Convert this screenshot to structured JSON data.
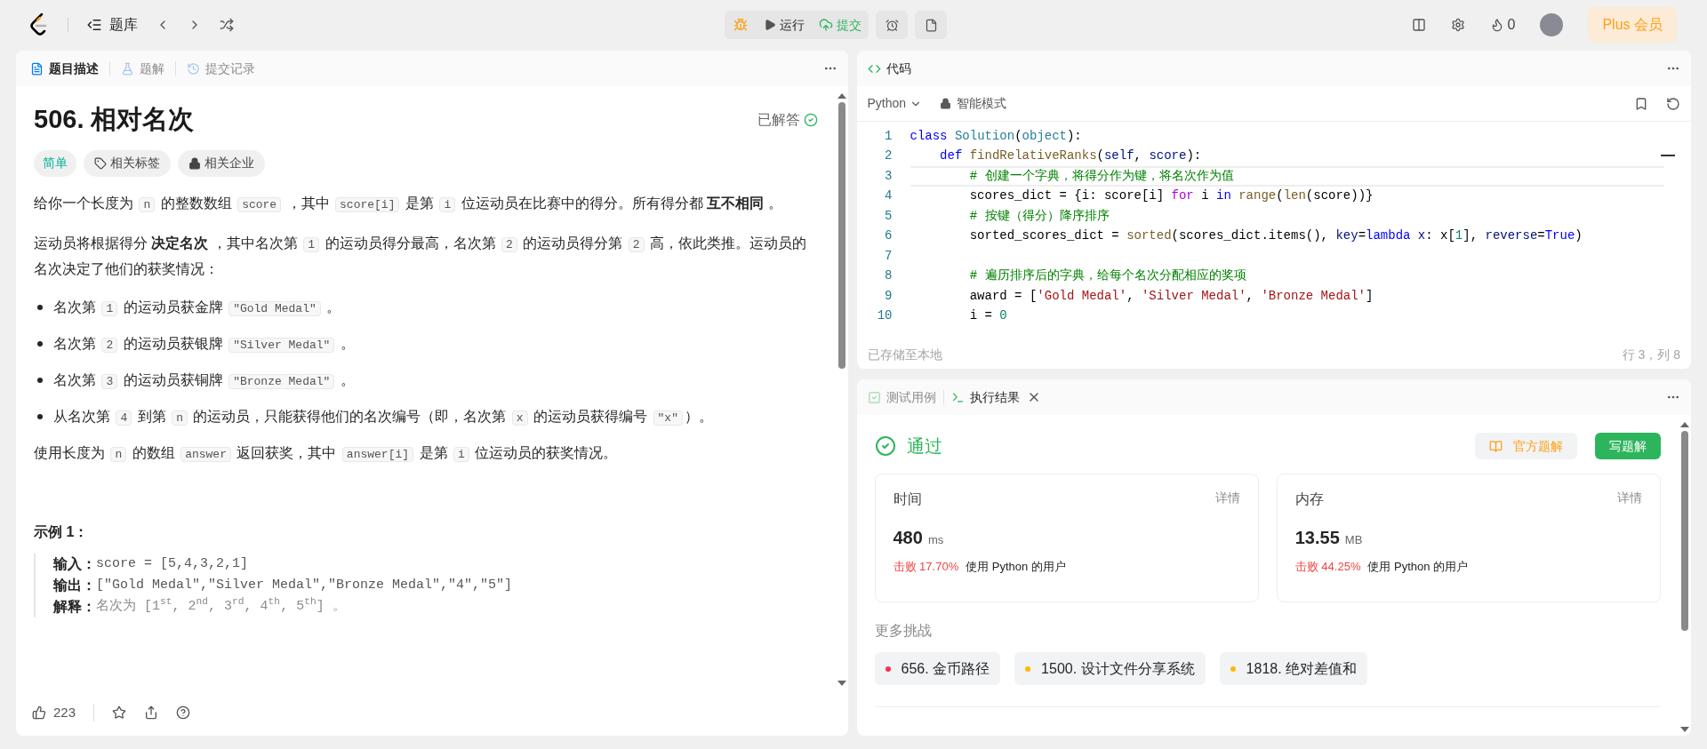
{
  "topbar": {
    "nav_title": "题库",
    "actions": [
      {
        "kind": "debug"
      },
      {
        "kind": "run",
        "label": "运行"
      },
      {
        "kind": "submit",
        "label": "提交"
      },
      {
        "kind": "timer"
      },
      {
        "kind": "note"
      }
    ],
    "fire_count": "0",
    "plus_label": "Plus 会员"
  },
  "problem": {
    "tabs": [
      {
        "label": "题目描述",
        "kind": "description",
        "selected": true
      },
      {
        "label": "题解",
        "kind": "solutions",
        "selected": false
      },
      {
        "label": "提交记录",
        "kind": "submissions",
        "selected": false
      }
    ],
    "title": "506. 相对名次",
    "status": "已解答",
    "tags": [
      {
        "label": "简单",
        "kind": "difficulty"
      },
      {
        "label": "相关标签",
        "kind": "topics"
      },
      {
        "label": "相关企业",
        "kind": "companies"
      }
    ],
    "blocks": [
      {
        "kind": "paragraph",
        "segments": [
          {
            "kind": "text",
            "text": "给你一个长度为 "
          },
          {
            "kind": "code",
            "text": "n"
          },
          {
            "kind": "text",
            "text": " 的整数数组 "
          },
          {
            "kind": "code",
            "text": "score"
          },
          {
            "kind": "text",
            "text": " ，其中 "
          },
          {
            "kind": "code",
            "text": "score[i]"
          },
          {
            "kind": "text",
            "text": " 是第 "
          },
          {
            "kind": "code",
            "text": "i"
          },
          {
            "kind": "text",
            "text": " 位运动员在比赛中的得分。所有得分都 "
          },
          {
            "kind": "bold",
            "text": "互不相同"
          },
          {
            "kind": "text",
            "text": " 。"
          }
        ]
      },
      {
        "kind": "paragraph",
        "segments": [
          {
            "kind": "text",
            "text": "运动员将根据得分 "
          },
          {
            "kind": "bold",
            "text": "决定名次"
          },
          {
            "kind": "text",
            "text": " ，其中名次第 "
          },
          {
            "kind": "code",
            "text": "1"
          },
          {
            "kind": "text",
            "text": " 的运动员得分最高，名次第 "
          },
          {
            "kind": "code",
            "text": "2"
          },
          {
            "kind": "text",
            "text": " 的运动员得分第 "
          },
          {
            "kind": "code",
            "text": "2"
          },
          {
            "kind": "text",
            "text": " 高，依此类推。运动员的名次决定了他们的获奖情况："
          }
        ]
      },
      {
        "kind": "bullet",
        "segments": [
          {
            "kind": "text",
            "text": "名次第 "
          },
          {
            "kind": "code",
            "text": "1"
          },
          {
            "kind": "text",
            "text": " 的运动员获金牌 "
          },
          {
            "kind": "code",
            "text": "\"Gold Medal\""
          },
          {
            "kind": "text",
            "text": " 。"
          }
        ]
      },
      {
        "kind": "bullet",
        "segments": [
          {
            "kind": "text",
            "text": "名次第 "
          },
          {
            "kind": "code",
            "text": "2"
          },
          {
            "kind": "text",
            "text": " 的运动员获银牌 "
          },
          {
            "kind": "code",
            "text": "\"Silver Medal\""
          },
          {
            "kind": "text",
            "text": " 。"
          }
        ]
      },
      {
        "kind": "bullet",
        "segments": [
          {
            "kind": "text",
            "text": "名次第 "
          },
          {
            "kind": "code",
            "text": "3"
          },
          {
            "kind": "text",
            "text": " 的运动员获铜牌 "
          },
          {
            "kind": "code",
            "text": "\"Bronze Medal\""
          },
          {
            "kind": "text",
            "text": " 。"
          }
        ]
      },
      {
        "kind": "bullet",
        "segments": [
          {
            "kind": "text",
            "text": "从名次第 "
          },
          {
            "kind": "code",
            "text": "4"
          },
          {
            "kind": "text",
            "text": " 到第 "
          },
          {
            "kind": "code",
            "text": "n"
          },
          {
            "kind": "text",
            "text": " 的运动员，只能获得他们的名次编号（即，名次第 "
          },
          {
            "kind": "code",
            "text": "x"
          },
          {
            "kind": "text",
            "text": " 的运动员获得编号 "
          },
          {
            "kind": "code",
            "text": "\"x\""
          },
          {
            "kind": "text",
            "text": "）。"
          }
        ]
      },
      {
        "kind": "paragraph",
        "segments": [
          {
            "kind": "text",
            "text": "使用长度为 "
          },
          {
            "kind": "code",
            "text": "n"
          },
          {
            "kind": "text",
            "text": " 的数组 "
          },
          {
            "kind": "code",
            "text": "answer"
          },
          {
            "kind": "text",
            "text": " 返回获奖，其中 "
          },
          {
            "kind": "code",
            "text": "answer[i]"
          },
          {
            "kind": "text",
            "text": " 是第 "
          },
          {
            "kind": "code",
            "text": "i"
          },
          {
            "kind": "text",
            "text": " 位运动员的获奖情况。"
          }
        ]
      }
    ],
    "example": {
      "heading": "示例 1：",
      "lines": [
        {
          "label": "输入：",
          "value": "score = [5,4,3,2,1]",
          "kind": "code"
        },
        {
          "label": "输出：",
          "value": "[\"Gold Medal\",\"Silver Medal\",\"Bronze Medal\",\"4\",\"5\"]",
          "kind": "code"
        },
        {
          "label": "解释：",
          "value": "名次为 [1$^{st}$, 2$^{nd}$, 3$^{rd}$, 4$^{th}$, 5$^{th}$] 。",
          "kind": "note"
        }
      ]
    },
    "likes": "223"
  },
  "editor": {
    "tab": "代码",
    "language": "Python",
    "mode": "智能模式",
    "lines": [
      {
        "number": "1",
        "selected": false,
        "tokens": [
          {
            "kind": "kw",
            "text": "class "
          },
          {
            "kind": "type",
            "text": "Solution"
          },
          {
            "kind": "plain",
            "text": "("
          },
          {
            "kind": "type",
            "text": "object"
          },
          {
            "kind": "plain",
            "text": "):"
          }
        ]
      },
      {
        "number": "2",
        "selected": false,
        "tokens": [
          {
            "kind": "kw",
            "text": "    def "
          },
          {
            "kind": "fn",
            "text": "findRelativeRanks"
          },
          {
            "kind": "plain",
            "text": "("
          },
          {
            "kind": "var",
            "text": "self"
          },
          {
            "kind": "plain",
            "text": ", "
          },
          {
            "kind": "var",
            "text": "score"
          },
          {
            "kind": "plain",
            "text": "):"
          }
        ]
      },
      {
        "number": "3",
        "selected": true,
        "tokens": [
          {
            "kind": "comment",
            "text": "        # 创建一个字典，将得分作为键，将名次作为值"
          }
        ]
      },
      {
        "number": "4",
        "selected": false,
        "tokens": [
          {
            "kind": "plain",
            "text": "        scores_dict = {i: score[i] "
          },
          {
            "kind": "ctrl",
            "text": "for"
          },
          {
            "kind": "plain",
            "text": " i "
          },
          {
            "kind": "kw",
            "text": "in "
          },
          {
            "kind": "fn",
            "text": "range"
          },
          {
            "kind": "plain",
            "text": "("
          },
          {
            "kind": "fn",
            "text": "len"
          },
          {
            "kind": "plain",
            "text": "(score))}"
          }
        ]
      },
      {
        "number": "5",
        "selected": false,
        "tokens": [
          {
            "kind": "comment",
            "text": "        # 按键（得分）降序排序"
          }
        ]
      },
      {
        "number": "6",
        "selected": false,
        "tokens": [
          {
            "kind": "plain",
            "text": "        sorted_scores_dict = "
          },
          {
            "kind": "fn",
            "text": "sorted"
          },
          {
            "kind": "plain",
            "text": "(scores_dict.items(), "
          },
          {
            "kind": "var",
            "text": "key"
          },
          {
            "kind": "plain",
            "text": "="
          },
          {
            "kind": "kw",
            "text": "lambda "
          },
          {
            "kind": "var",
            "text": "x"
          },
          {
            "kind": "plain",
            "text": ": x["
          },
          {
            "kind": "num",
            "text": "1"
          },
          {
            "kind": "plain",
            "text": "], "
          },
          {
            "kind": "var",
            "text": "reverse"
          },
          {
            "kind": "plain",
            "text": "="
          },
          {
            "kind": "kw",
            "text": "True"
          },
          {
            "kind": "plain",
            "text": ")"
          }
        ]
      },
      {
        "number": "7",
        "selected": false
      },
      {
        "number": "8",
        "selected": false,
        "tokens": [
          {
            "kind": "comment",
            "text": "        # 遍历排序后的字典，给每个名次分配相应的奖项"
          }
        ]
      },
      {
        "number": "9",
        "selected": false,
        "tokens": [
          {
            "kind": "plain",
            "text": "        award = ["
          },
          {
            "kind": "str",
            "text": "'Gold Medal'"
          },
          {
            "kind": "plain",
            "text": ", "
          },
          {
            "kind": "str",
            "text": "'Silver Medal'"
          },
          {
            "kind": "plain",
            "text": ", "
          },
          {
            "kind": "str",
            "text": "'Bronze Medal'"
          },
          {
            "kind": "plain",
            "text": "]"
          }
        ]
      },
      {
        "number": "10",
        "selected": false,
        "tokens": [
          {
            "kind": "plain",
            "text": "        i = "
          },
          {
            "kind": "num",
            "text": "0"
          }
        ]
      }
    ],
    "saved": "已存储至本地",
    "cursor": "行 3，列 8"
  },
  "result": {
    "tabs": [
      {
        "label": "测试用例",
        "kind": "testcase",
        "selected": false
      },
      {
        "label": "执行结果",
        "kind": "result",
        "selected": true
      }
    ],
    "status": "通过",
    "official_button": "官方题解",
    "write_button": "写题解",
    "cards": [
      {
        "label": "时间",
        "detail": "详情",
        "value": "480",
        "unit": "ms",
        "beat": "击败 17.70%",
        "suffix": "使用 Python 的用户"
      },
      {
        "label": "内存",
        "detail": "详情",
        "value": "13.55",
        "unit": "MB",
        "beat": "击败 44.25%",
        "suffix": "使用 Python 的用户"
      }
    ],
    "more_heading": "更多挑战",
    "challenges": [
      {
        "label": "656. 金币路径",
        "color": "#ff2d55"
      },
      {
        "label": "1500. 设计文件分享系统",
        "color": "#ffb800"
      },
      {
        "label": "1818. 绝对差值和",
        "color": "#ffb800"
      }
    ]
  }
}
